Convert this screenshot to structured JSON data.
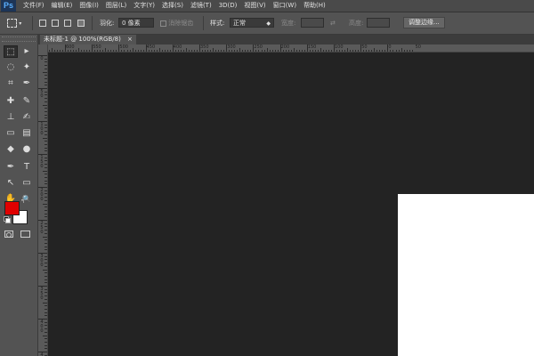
{
  "app": {
    "logo": "Ps"
  },
  "menu": [
    "文件(F)",
    "编辑(E)",
    "图像(I)",
    "图层(L)",
    "文字(Y)",
    "选择(S)",
    "滤镜(T)",
    "3D(D)",
    "视图(V)",
    "窗口(W)",
    "帮助(H)"
  ],
  "options": {
    "feather_label": "羽化:",
    "feather_value": "0 像素",
    "antialias_label": "消除锯齿",
    "style_label": "样式:",
    "style_value": "正常",
    "width_label": "宽度:",
    "height_label": "高度:",
    "refine_edge": "调整边缘..."
  },
  "document": {
    "tab_title": "未标题-1 @ 100%(RGB/8)",
    "close": "×"
  },
  "ruler": {
    "h_labels": [
      "600",
      "550",
      "500",
      "450",
      "400",
      "350",
      "300",
      "250",
      "200",
      "150",
      "100",
      "50",
      "0",
      "50"
    ],
    "v_labels": [
      "0",
      "5 0",
      "1 0 0",
      "1 5 0",
      "2 0 0",
      "2 5 0",
      "3 0 0",
      "3 5 0",
      "4 0 0",
      "4 5 0"
    ]
  },
  "colors": {
    "foreground": "#e00000",
    "background": "#ffffff",
    "canvas_bg": "#232323"
  },
  "tools": [
    "marquee-icon",
    "move-icon",
    "lasso-icon",
    "magic-wand-icon",
    "crop-icon",
    "eyedropper-icon",
    "healing-brush-icon",
    "brush-icon",
    "clone-stamp-icon",
    "history-brush-icon",
    "eraser-icon",
    "gradient-icon",
    "blur-icon",
    "dodge-icon",
    "pen-icon",
    "type-icon",
    "path-selection-icon",
    "shape-icon",
    "hand-icon",
    "zoom-icon"
  ],
  "tool_glyphs": [
    "⬚",
    "▸",
    "◌",
    "✦",
    "⌗",
    "✒",
    "✚",
    "✎",
    "⊥",
    "✍",
    "▭",
    "▤",
    "◆",
    "●",
    "✒",
    "T",
    "↖",
    "▭",
    "✋",
    "🔍"
  ]
}
